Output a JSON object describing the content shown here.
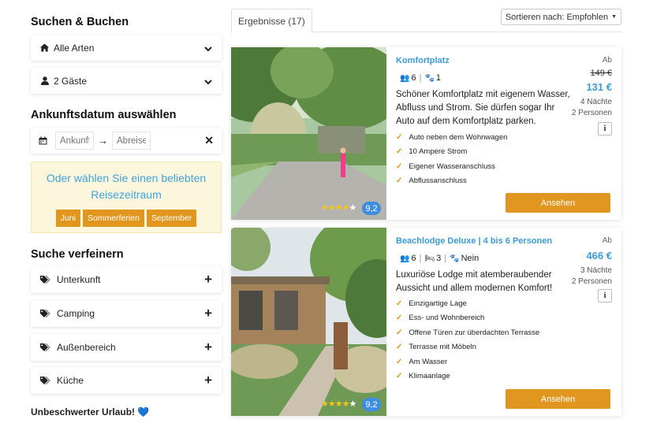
{
  "sidebar": {
    "heading_book": "Suchen & Buchen",
    "type_dropdown": {
      "label": "Alle Arten",
      "icon": "home-icon"
    },
    "guests_dropdown": {
      "label": "2 Gäste",
      "icon": "user-icon"
    },
    "heading_date": "Ankunftsdatum auswählen",
    "date": {
      "arrival_placeholder": "Ankunft",
      "departure_placeholder": "Abreise"
    },
    "promo": {
      "text": "Oder wählen Sie einen beliebten Reisezeitraum",
      "buttons": [
        "Juni",
        "Sommerferien",
        "September"
      ]
    },
    "heading_refine": "Suche verfeinern",
    "filters": [
      "Unterkunft",
      "Camping",
      "Außenbereich",
      "Küche"
    ],
    "footer_note": "Unbeschwerter Urlaub! 💙"
  },
  "main": {
    "tab_label": "Ergebnisse (17)",
    "sort_label": "Sortieren nach: Empfohlen"
  },
  "colors": {
    "accent": "#e0961f",
    "link": "#3c9bd6",
    "promo_bg": "#fcf6dd",
    "score": "#3d8de0"
  },
  "results": [
    {
      "title": "Komfortplatz",
      "meta": {
        "persons": "6",
        "pets": "1"
      },
      "description": "Schöner Komfortplatz mit eigenem Wasser, Abfluss und Strom. Sie dürfen sogar Ihr Auto auf dem Komfortplatz parken.",
      "features": [
        "Auto neben dem Wohnwagen",
        "10 Ampere Strom",
        "Eigener Wasseranschluss",
        "Abflussanschluss"
      ],
      "price": {
        "ab": "Ab",
        "old": "149 €",
        "new": "131 €",
        "nights": "4 Nächte",
        "persons": "2 Personen"
      },
      "rating": "9,2",
      "stars": 4.5,
      "button": "Ansehen"
    },
    {
      "title": "Beachlodge Deluxe | 4 bis 6 Personen",
      "meta": {
        "persons": "6",
        "bedrooms": "3",
        "pets": "Nein"
      },
      "description": "Luxuriöse Lodge mit atemberaubender Aussicht und allem modernen Komfort!",
      "features": [
        "Einzigartige Lage",
        "Ess- und Wohnbereich",
        "Offene Türen zur überdachten Terrasse",
        "Terrasse mit Möbeln",
        "Am Wasser",
        "Klimaanlage"
      ],
      "price": {
        "ab": "Ab",
        "new": "466 €",
        "nights": "3 Nächte",
        "persons": "2 Personen"
      },
      "rating": "9,2",
      "stars": 4.5,
      "button": "Ansehen"
    }
  ]
}
